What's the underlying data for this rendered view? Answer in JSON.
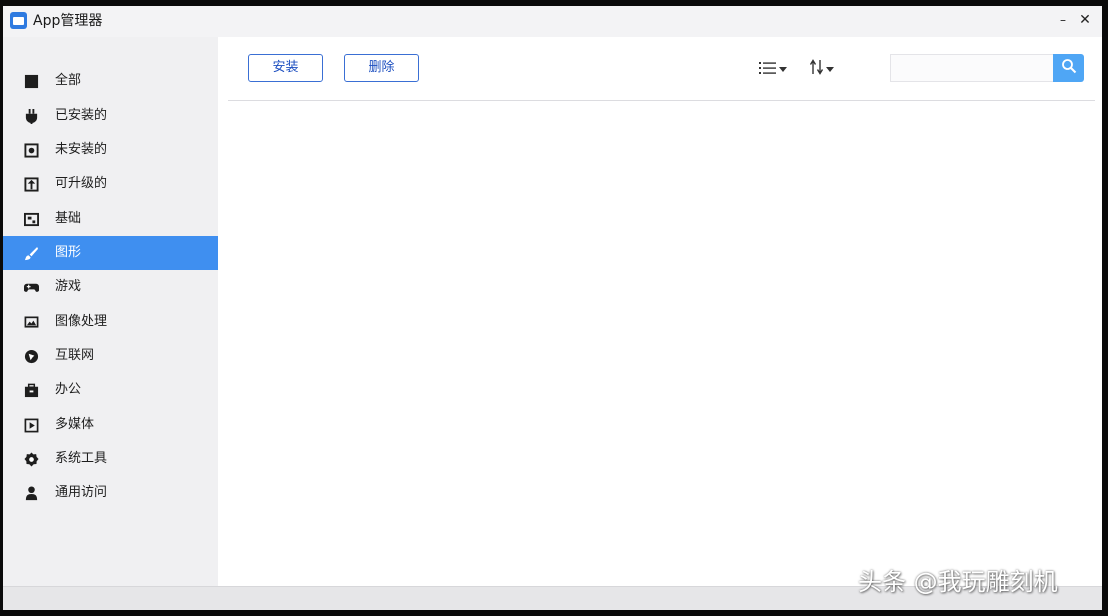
{
  "window": {
    "title": "App管理器",
    "minimize_glyph": "–",
    "close_glyph": "✕"
  },
  "sidebar": {
    "items": [
      {
        "label": "全部",
        "icon": "grid-icon",
        "active": false
      },
      {
        "label": "已安装的",
        "icon": "plug-icon",
        "active": false
      },
      {
        "label": "未安装的",
        "icon": "box-icon",
        "active": false
      },
      {
        "label": "可升级的",
        "icon": "upgrade-icon",
        "active": false
      },
      {
        "label": "基础",
        "icon": "cube-icon",
        "active": false
      },
      {
        "label": "图形",
        "icon": "brush-icon",
        "active": true
      },
      {
        "label": "游戏",
        "icon": "gamepad-icon",
        "active": false
      },
      {
        "label": "图像处理",
        "icon": "image-icon",
        "active": false
      },
      {
        "label": "互联网",
        "icon": "globe-icon",
        "active": false
      },
      {
        "label": "办公",
        "icon": "briefcase-icon",
        "active": false
      },
      {
        "label": "多媒体",
        "icon": "play-icon",
        "active": false
      },
      {
        "label": "系统工具",
        "icon": "gear-icon",
        "active": false
      },
      {
        "label": "通用访问",
        "icon": "person-icon",
        "active": false
      }
    ]
  },
  "toolbar": {
    "install_label": "安装",
    "delete_label": "删除",
    "view_icon": "list-view-icon",
    "sort_icon": "sort-icon",
    "search_placeholder": "",
    "search_icon": "search-icon"
  },
  "watermark": {
    "text": "头条 @我玩雕刻机"
  },
  "colors": {
    "accent": "#3f8ff0",
    "button_border": "#3a6fd4",
    "search_button": "#4fa6f5",
    "sidebar_bg": "#f0f0f2"
  }
}
